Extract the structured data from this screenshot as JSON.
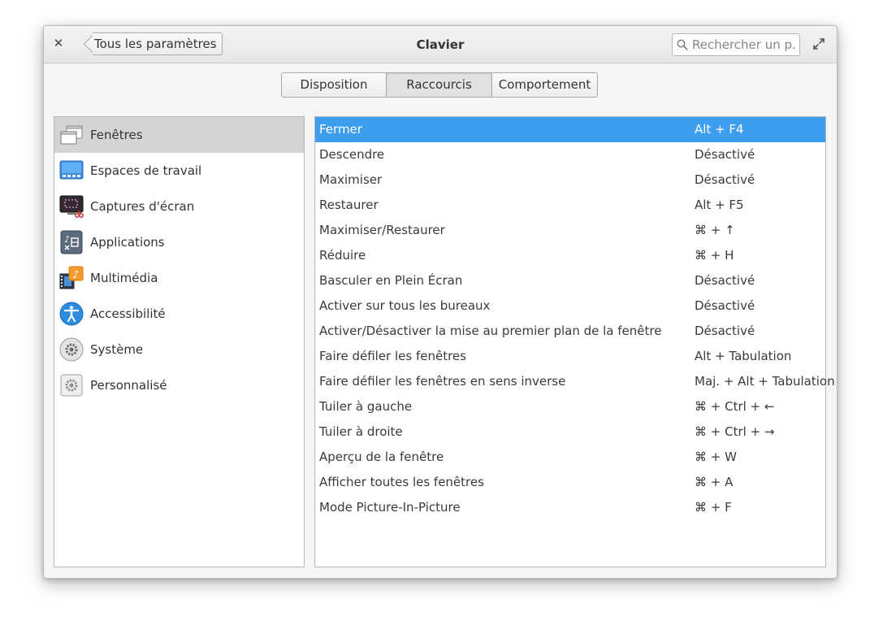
{
  "window": {
    "title": "Clavier",
    "back_label": "Tous les paramètres",
    "search_placeholder": "Rechercher un p...",
    "close_icon": "close-icon",
    "maximize_icon": "maximize-icon"
  },
  "tabs": [
    {
      "label": "Disposition"
    },
    {
      "label": "Raccourcis"
    },
    {
      "label": "Comportement"
    }
  ],
  "active_tab": "Raccourcis",
  "sidebar": {
    "items": [
      {
        "label": "Fenêtres",
        "icon": "windows-icon"
      },
      {
        "label": "Espaces de travail",
        "icon": "workspaces-icon"
      },
      {
        "label": "Captures d'écran",
        "icon": "screenshot-icon"
      },
      {
        "label": "Applications",
        "icon": "applications-icon"
      },
      {
        "label": "Multimédia",
        "icon": "multimedia-icon"
      },
      {
        "label": "Accessibilité",
        "icon": "accessibility-icon"
      },
      {
        "label": "Système",
        "icon": "system-icon"
      },
      {
        "label": "Personnalisé",
        "icon": "custom-icon"
      }
    ],
    "selected": "Fenêtres"
  },
  "shortcuts": [
    {
      "name": "Fermer",
      "accel": "Alt + F4"
    },
    {
      "name": "Descendre",
      "accel": "Désactivé"
    },
    {
      "name": "Maximiser",
      "accel": "Désactivé"
    },
    {
      "name": "Restaurer",
      "accel": "Alt + F5"
    },
    {
      "name": "Maximiser/Restaurer",
      "accel": "⌘ + ↑"
    },
    {
      "name": "Réduire",
      "accel": "⌘ + H"
    },
    {
      "name": "Basculer en Plein Écran",
      "accel": "Désactivé"
    },
    {
      "name": "Activer sur tous les bureaux",
      "accel": "Désactivé"
    },
    {
      "name": "Activer/Désactiver la mise au premier plan de la fenêtre",
      "accel": "Désactivé"
    },
    {
      "name": "Faire défiler les fenêtres",
      "accel": "Alt + Tabulation"
    },
    {
      "name": "Faire défiler les fenêtres en sens inverse",
      "accel": "Maj. + Alt + Tabulation"
    },
    {
      "name": "Tuiler à gauche",
      "accel": "⌘ + Ctrl + ←"
    },
    {
      "name": "Tuiler à droite",
      "accel": "⌘ + Ctrl + →"
    },
    {
      "name": "Aperçu de la fenêtre",
      "accel": "⌘ + W"
    },
    {
      "name": "Afficher toutes les fenêtres",
      "accel": "⌘ + A"
    },
    {
      "name": "Mode Picture-In-Picture",
      "accel": "⌘ + F"
    }
  ],
  "selected_shortcut": "Fermer",
  "colors": {
    "selection": "#3d9ef0",
    "sidebar_selection": "#d4d4d4"
  }
}
